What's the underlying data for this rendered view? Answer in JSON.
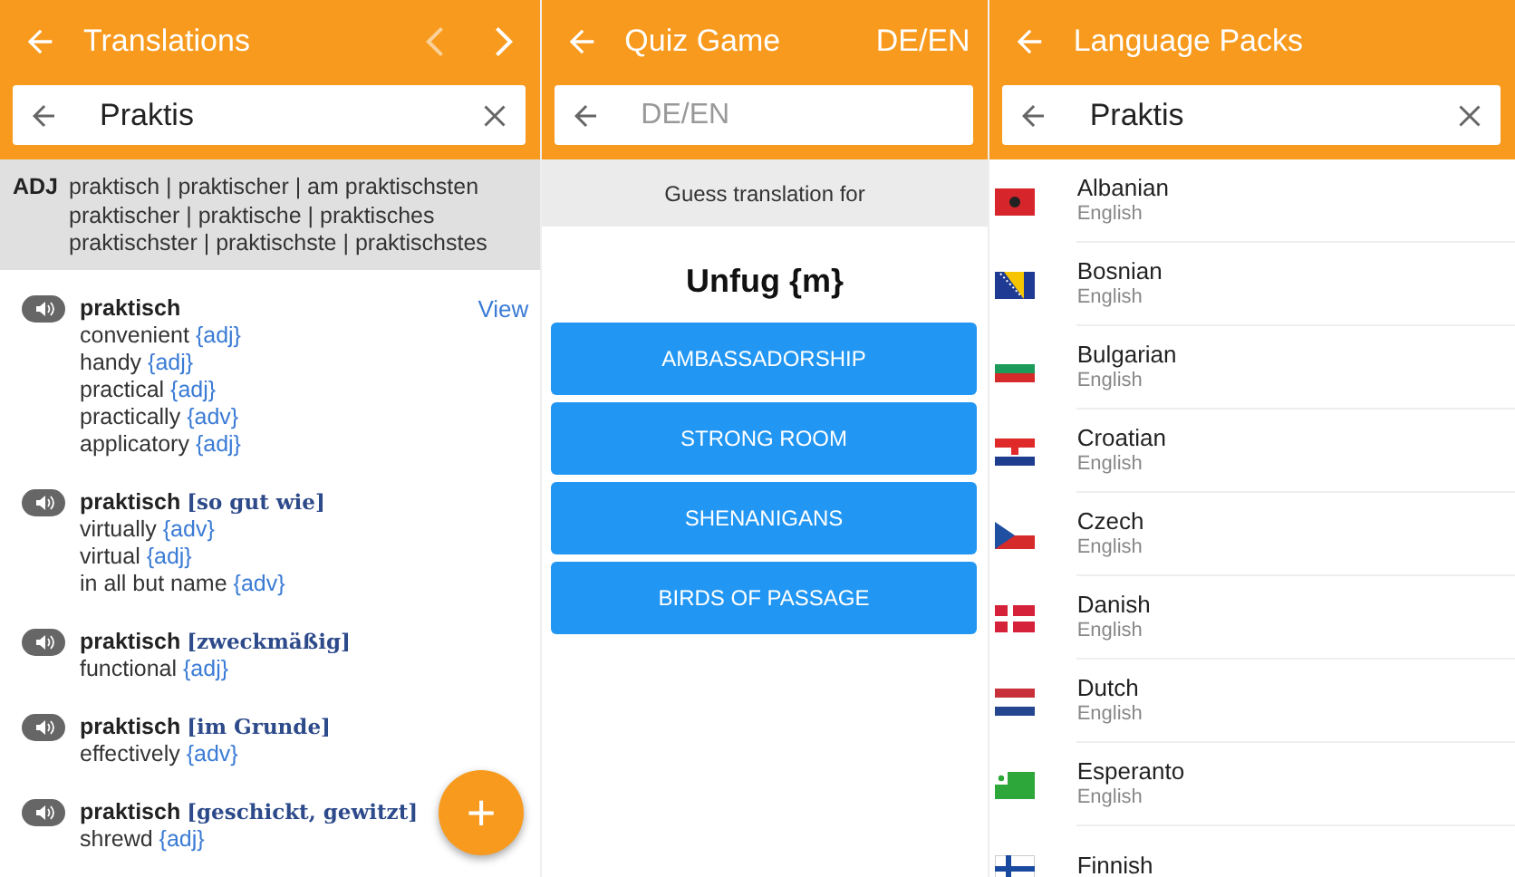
{
  "translations": {
    "title": "Translations",
    "nav": [
      {
        "kind": "prev",
        "disabled": true
      },
      {
        "kind": "next",
        "disabled": false
      }
    ],
    "search": {
      "value": "Praktis"
    },
    "inflection": {
      "label": "ADJ",
      "lines": [
        "praktisch | praktischer | am praktischsten",
        "praktischer | praktische | praktisches",
        "praktischster | praktischste | praktischstes"
      ]
    },
    "entries": [
      {
        "headword": "praktisch",
        "action": "View",
        "translations": [
          {
            "text": "convenient",
            "pos": "{adj}"
          },
          {
            "text": "handy",
            "pos": "{adj}"
          },
          {
            "text": "practical",
            "pos": "{adj}"
          },
          {
            "text": "practically",
            "pos": "{adv}"
          },
          {
            "text": "applicatory",
            "pos": "{adj}"
          }
        ]
      },
      {
        "headword": "praktisch",
        "context": "[so gut wie]",
        "translations": [
          {
            "text": "virtually",
            "pos": "{adv}"
          },
          {
            "text": "virtual",
            "pos": "{adj}"
          },
          {
            "text": "in all but name",
            "pos": "{adv}"
          }
        ]
      },
      {
        "headword": "praktisch",
        "context": "[zweckmäßig]",
        "translations": [
          {
            "text": "functional",
            "pos": "{adj}"
          }
        ]
      },
      {
        "headword": "praktisch",
        "context": "[im Grunde]",
        "translations": [
          {
            "text": "effectively",
            "pos": "{adv}"
          }
        ]
      },
      {
        "headword": "praktisch",
        "context": "[geschickt, gewitzt]",
        "translations": [
          {
            "text": "shrewd",
            "pos": "{adj}"
          }
        ]
      }
    ],
    "fab": "+"
  },
  "quiz": {
    "title": "Quiz Game",
    "language_pair": "DE/EN",
    "search": {
      "placeholder": "DE/EN"
    },
    "prompt": "Guess translation for",
    "word": "Unfug {m}",
    "answers": [
      "AMBASSADORSHIP",
      "STRONG ROOM",
      "SHENANIGANS",
      "BIRDS OF PASSAGE"
    ]
  },
  "language_packs": {
    "title": "Language Packs",
    "search": {
      "value": "Praktis"
    },
    "items": [
      {
        "kind": "albania",
        "name": "Albanian",
        "subtitle": "English"
      },
      {
        "kind": "bosnia",
        "name": "Bosnian",
        "subtitle": "English"
      },
      {
        "kind": "bulgaria",
        "name": "Bulgarian",
        "subtitle": "English"
      },
      {
        "kind": "croatia",
        "name": "Croatian",
        "subtitle": "English"
      },
      {
        "kind": "czech",
        "name": "Czech",
        "subtitle": "English"
      },
      {
        "kind": "denmark",
        "name": "Danish",
        "subtitle": "English"
      },
      {
        "kind": "netherlands",
        "name": "Dutch",
        "subtitle": "English"
      },
      {
        "kind": "esperanto",
        "name": "Esperanto",
        "subtitle": "English"
      },
      {
        "kind": "finland",
        "name": "Finnish"
      }
    ]
  }
}
